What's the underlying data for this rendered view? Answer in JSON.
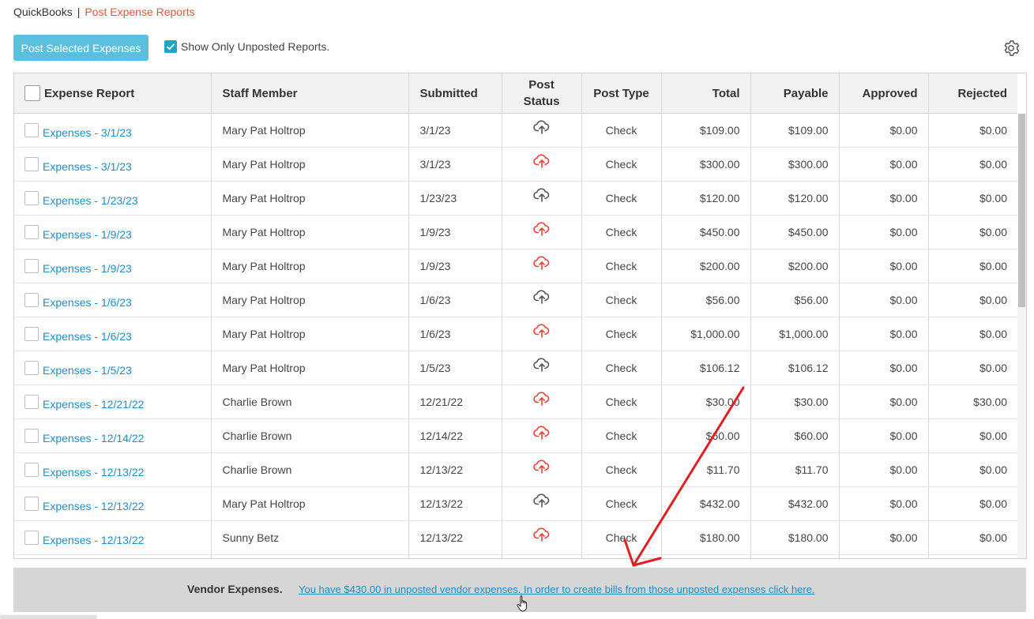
{
  "breadcrumb": {
    "root": "QuickBooks",
    "separator": "|",
    "current": "Post Expense Reports"
  },
  "toolbar": {
    "post_button": "Post Selected Expenses",
    "show_only_label": "Show Only Unposted Reports.",
    "show_only_checked": true
  },
  "columns": [
    "Expense Report",
    "Staff Member",
    "Submitted",
    "Post\nStatus",
    "Post Type",
    "Total",
    "Payable",
    "Approved",
    "Rejected"
  ],
  "rows": [
    {
      "report": "Expenses - 3/1/23",
      "staff": "Mary Pat Holtrop",
      "submitted": "3/1/23",
      "status": "posted",
      "post_type": "Check",
      "total": "$109.00",
      "payable": "$109.00",
      "approved": "$0.00",
      "rejected": "$0.00"
    },
    {
      "report": "Expenses - 3/1/23",
      "staff": "Mary Pat Holtrop",
      "submitted": "3/1/23",
      "status": "unposted",
      "post_type": "Check",
      "total": "$300.00",
      "payable": "$300.00",
      "approved": "$0.00",
      "rejected": "$0.00"
    },
    {
      "report": "Expenses - 1/23/23",
      "staff": "Mary Pat Holtrop",
      "submitted": "1/23/23",
      "status": "posted",
      "post_type": "Check",
      "total": "$120.00",
      "payable": "$120.00",
      "approved": "$0.00",
      "rejected": "$0.00"
    },
    {
      "report": "Expenses - 1/9/23",
      "staff": "Mary Pat Holtrop",
      "submitted": "1/9/23",
      "status": "unposted",
      "post_type": "Check",
      "total": "$450.00",
      "payable": "$450.00",
      "approved": "$0.00",
      "rejected": "$0.00"
    },
    {
      "report": "Expenses - 1/9/23",
      "staff": "Mary Pat Holtrop",
      "submitted": "1/9/23",
      "status": "unposted",
      "post_type": "Check",
      "total": "$200.00",
      "payable": "$200.00",
      "approved": "$0.00",
      "rejected": "$0.00"
    },
    {
      "report": "Expenses - 1/6/23",
      "staff": "Mary Pat Holtrop",
      "submitted": "1/6/23",
      "status": "posted",
      "post_type": "Check",
      "total": "$56.00",
      "payable": "$56.00",
      "approved": "$0.00",
      "rejected": "$0.00"
    },
    {
      "report": "Expenses - 1/6/23",
      "staff": "Mary Pat Holtrop",
      "submitted": "1/6/23",
      "status": "unposted",
      "post_type": "Check",
      "total": "$1,000.00",
      "payable": "$1,000.00",
      "approved": "$0.00",
      "rejected": "$0.00"
    },
    {
      "report": "Expenses - 1/5/23",
      "staff": "Mary Pat Holtrop",
      "submitted": "1/5/23",
      "status": "posted",
      "post_type": "Check",
      "total": "$106.12",
      "payable": "$106.12",
      "approved": "$0.00",
      "rejected": "$0.00"
    },
    {
      "report": "Expenses - 12/21/22",
      "staff": "Charlie Brown",
      "submitted": "12/21/22",
      "status": "unposted",
      "post_type": "Check",
      "total": "$30.00",
      "payable": "$30.00",
      "approved": "$0.00",
      "rejected": "$30.00"
    },
    {
      "report": "Expenses - 12/14/22",
      "staff": "Charlie Brown",
      "submitted": "12/14/22",
      "status": "unposted",
      "post_type": "Check",
      "total": "$60.00",
      "payable": "$60.00",
      "approved": "$0.00",
      "rejected": "$0.00"
    },
    {
      "report": "Expenses - 12/13/22",
      "staff": "Charlie Brown",
      "submitted": "12/13/22",
      "status": "unposted",
      "post_type": "Check",
      "total": "$11.70",
      "payable": "$11.70",
      "approved": "$0.00",
      "rejected": "$0.00"
    },
    {
      "report": "Expenses - 12/13/22",
      "staff": "Mary Pat Holtrop",
      "submitted": "12/13/22",
      "status": "posted",
      "post_type": "Check",
      "total": "$432.00",
      "payable": "$432.00",
      "approved": "$0.00",
      "rejected": "$0.00"
    },
    {
      "report": "Expenses - 12/13/22",
      "staff": "Sunny Betz",
      "submitted": "12/13/22",
      "status": "unposted",
      "post_type": "Check",
      "total": "$180.00",
      "payable": "$180.00",
      "approved": "$0.00",
      "rejected": "$0.00"
    },
    {
      "report": "",
      "staff": "",
      "submitted": "",
      "status": "unposted",
      "post_type": "",
      "total": "",
      "payable": "",
      "approved": "",
      "rejected": ""
    }
  ],
  "vendor": {
    "label": "Vendor Expenses.",
    "link": "You have $430.00 in unposted vendor expenses. In order to create bills from those unposted expenses click here."
  },
  "colors": {
    "accent": "#5bc0de",
    "link": "#1f8dc0",
    "breadcrumb_current": "#e8533f",
    "unposted_icon": "#e8433a",
    "posted_icon": "#555555",
    "annotation_arrow": "#e02020"
  },
  "icons": {
    "settings": "gear-icon",
    "posted": "cloud-upload-icon",
    "unposted": "cloud-upload-icon-red",
    "cursor": "hand-pointer-icon"
  }
}
